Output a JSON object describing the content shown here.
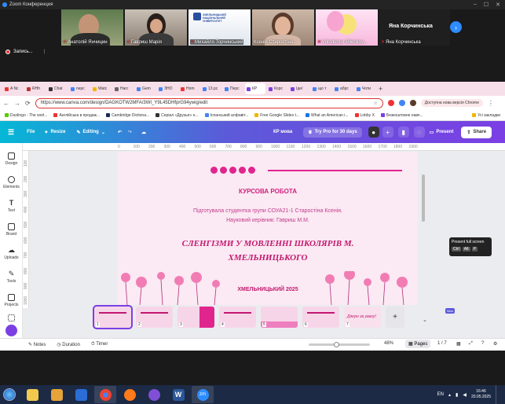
{
  "zoom": {
    "title": "Zoom Конференция",
    "next": "›",
    "participants": [
      {
        "name": "Анатолій Янчицин"
      },
      {
        "name": "Гавриш Марія"
      },
      {
        "name": "Михайло Торчинський",
        "logo_text": "ХМЕЛЬНИЦЬКИЙ НАЦІОНАЛЬНИЙ УНІВЕРСИТЕТ"
      },
      {
        "name": "Ксенія Старостіна"
      },
      {
        "name": "Volodumur Bilenkov..."
      },
      {
        "name": "Яна Корчинська",
        "big": "Яна Корчинська"
      }
    ],
    "recording": "Запись...",
    "recording_sep": "|"
  },
  "browser": {
    "tabs": [
      {
        "label": "A Nc",
        "color": "#e33"
      },
      {
        "label": "RHh",
        "color": "#b33"
      },
      {
        "label": "Chat",
        "color": "#333"
      },
      {
        "label": "перс",
        "color": "#4285f4"
      },
      {
        "label": "Watc",
        "color": "#f4b400"
      },
      {
        "label": "Harc",
        "color": "#666"
      },
      {
        "label": "Gem",
        "color": "#4285f4"
      },
      {
        "label": "ЗНО",
        "color": "#4285f4"
      },
      {
        "label": "Hom",
        "color": "#e33"
      },
      {
        "label": "13.рс",
        "color": "#4285f4"
      },
      {
        "label": "Перс",
        "color": "#4285f4"
      },
      {
        "label": "КР",
        "color": "#7b3fe4",
        "active": true
      },
      {
        "label": "Корс",
        "color": "#7b3fe4"
      },
      {
        "label": "Ідеї",
        "color": "#7b3fe4"
      },
      {
        "label": "що т",
        "color": "#4285f4"
      },
      {
        "label": "абрс",
        "color": "#4285f4"
      },
      {
        "label": "Чоти",
        "color": "#4285f4"
      }
    ],
    "tab_plus": "+",
    "url": "https://www.canva.com/design/DAGKOTW2MFA/3WI_Y9L45DHfprG94ywig/edit",
    "update_label": "Доступна нова версія Chrome",
    "bookmarks": [
      {
        "label": "Duolingo - The worl...",
        "color": "#58cc02"
      },
      {
        "label": "Англійська в продаж...",
        "color": "#e33"
      },
      {
        "label": "Cambridge Dictiona...",
        "color": "#1d2a57"
      },
      {
        "label": "Серіал «Друзья» н...",
        "color": "#333"
      },
      {
        "label": "Іспанський алфавіт...",
        "color": "#4285f4"
      },
      {
        "label": "Free Google Slides t...",
        "color": "#f4b400"
      },
      {
        "label": "What an American i...",
        "color": "#1a73e8"
      },
      {
        "label": "Lobby X",
        "color": "#e33"
      },
      {
        "label": "Безкоштовне навч...",
        "color": "#7b3fe4"
      }
    ],
    "bookmarks_all": "Усі закладки"
  },
  "canva": {
    "file": "File",
    "resize": "Resize",
    "editing": "Editing",
    "doc_title": "КР мова",
    "try_pro": "Try Pro for 30 days",
    "present": "Present",
    "share": "Share",
    "sidebar": [
      {
        "label": "Design"
      },
      {
        "label": "Elements"
      },
      {
        "label": "Text"
      },
      {
        "label": "Brand"
      },
      {
        "label": "Uploads"
      },
      {
        "label": "Tools"
      },
      {
        "label": "Projects"
      }
    ],
    "ruler_h": [
      "0",
      "100",
      "200",
      "300",
      "400",
      "500",
      "600",
      "700",
      "800",
      "900",
      "1000",
      "1100",
      "1200",
      "1300",
      "1400",
      "1500",
      "1600",
      "1700",
      "1800",
      "1900"
    ],
    "ruler_v": [
      "100",
      "200",
      "300",
      "400",
      "500",
      "600",
      "700",
      "800",
      "900",
      "1000"
    ],
    "slide": {
      "heading": "КУРСОВА РОБОТА",
      "author_line": "Підготувала студентка групи СОУА21-1 Старостіна Ксенія.",
      "advisor_line": "Науковий керівник: Гавриш М.М.",
      "title_line1": "СЛЕНГІЗМИ У МОВЛЕННІ ШКОЛЯРІВ М.",
      "title_line2": "ХМЕЛЬНИЦЬКОГО",
      "city": "ХМЕЛЬНИЦЬКИЙ 2025"
    },
    "thumbnails": [
      {
        "num": "1"
      },
      {
        "num": "2"
      },
      {
        "num": "3"
      },
      {
        "num": "4"
      },
      {
        "num": "5"
      },
      {
        "num": "6"
      },
      {
        "num": "7",
        "text": "Дякую за увагу!"
      }
    ],
    "add_page": "+",
    "new_badge": "New",
    "tooltip_title": "Present full screen",
    "tooltip_keys": [
      "Ctrl",
      "Alt",
      "P"
    ],
    "footer": {
      "notes": "Notes",
      "duration": "Duration",
      "timer": "Timer",
      "zoom_pct": "48%",
      "pages": "Pages",
      "page_count": "1 / 7"
    }
  },
  "taskbar": {
    "lang": "EN",
    "time": "16:46",
    "date": "20.05.2025",
    "apps": [
      {
        "name": "explorer",
        "color": "#f2c94c"
      },
      {
        "name": "files",
        "color": "#e5a33a"
      },
      {
        "name": "store",
        "color": "#2b6cd6"
      },
      {
        "name": "chrome",
        "color": "#ea4335"
      },
      {
        "name": "firefox",
        "color": "#ff7a1a"
      },
      {
        "name": "viber",
        "color": "#7f4fd6"
      },
      {
        "name": "word",
        "color": "#2b579a"
      },
      {
        "name": "zoom",
        "color": "#2d8cff"
      }
    ],
    "zoom_label": "zm",
    "word_label": "W"
  }
}
